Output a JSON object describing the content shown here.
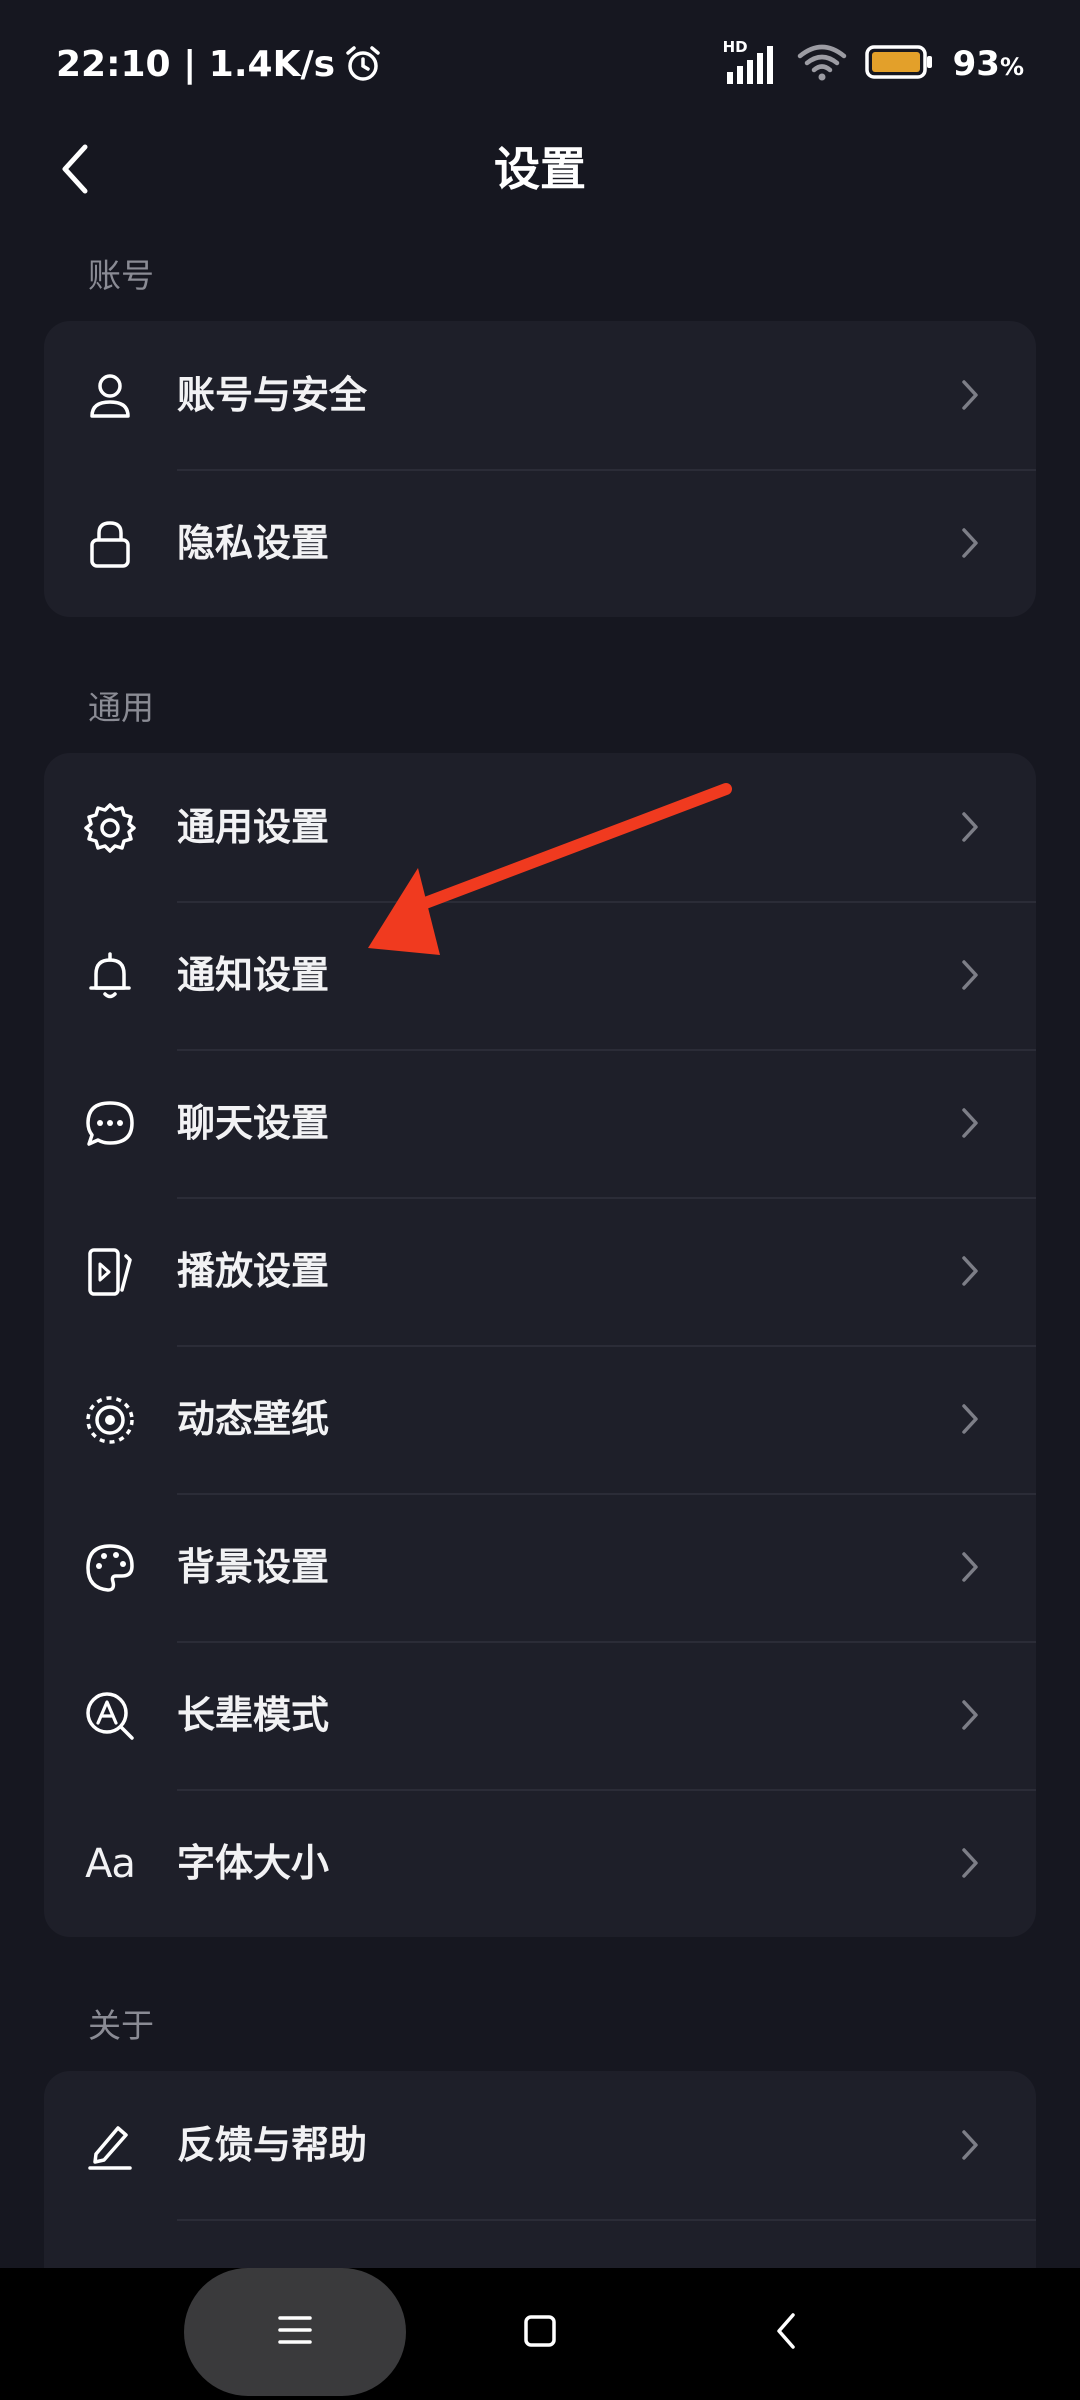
{
  "status_bar": {
    "time_speed": "22:10 | 1.4K/s",
    "network_badge": "HD",
    "battery_percent": "93",
    "battery_percent_sign": "%",
    "icons": [
      "alarm-icon",
      "signal-icon",
      "wifi-icon",
      "battery-icon"
    ]
  },
  "header": {
    "title": "设置",
    "back_icon": "chevron-left-icon"
  },
  "sections": [
    {
      "label": "账号",
      "items": [
        {
          "label": "账号与安全",
          "icon": "user-icon"
        },
        {
          "label": "隐私设置",
          "icon": "lock-icon"
        }
      ]
    },
    {
      "label": "通用",
      "items": [
        {
          "label": "通用设置",
          "icon": "gear-icon"
        },
        {
          "label": "通知设置",
          "icon": "bell-icon"
        },
        {
          "label": "聊天设置",
          "icon": "chat-icon"
        },
        {
          "label": "播放设置",
          "icon": "play-icon"
        },
        {
          "label": "动态壁纸",
          "icon": "live-wallpaper-icon"
        },
        {
          "label": "背景设置",
          "icon": "palette-icon"
        },
        {
          "label": "长辈模式",
          "icon": "elder-mode-icon"
        },
        {
          "label": "字体大小",
          "icon": "font-size-icon",
          "icon_text": "Aa"
        }
      ]
    },
    {
      "label": "关于",
      "items": [
        {
          "label": "反馈与帮助",
          "icon": "edit-icon"
        }
      ]
    }
  ],
  "annotation": {
    "color": "#f03a1f",
    "points_to": "通知设置"
  },
  "colors": {
    "background": "#161720",
    "card": "#1e1f29",
    "section_label": "#8a8b94",
    "battery_fill": "#e3a02a"
  },
  "nav_bar": {
    "icons": [
      "menu-icon",
      "home-square-icon",
      "back-triangle-icon"
    ]
  }
}
